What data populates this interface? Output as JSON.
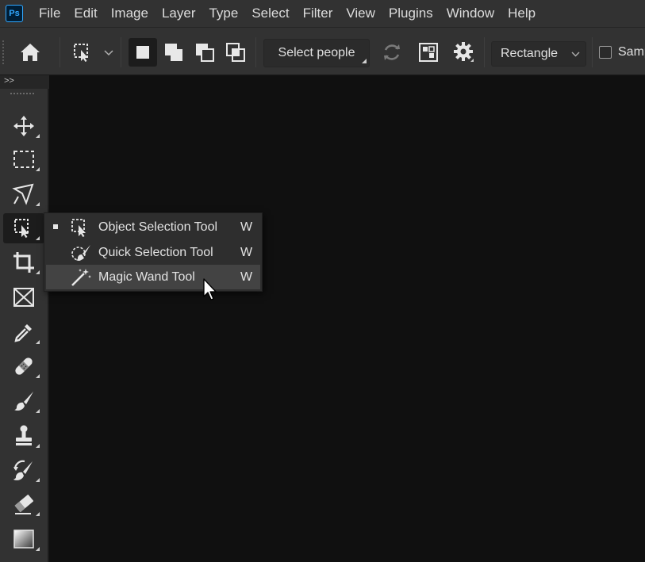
{
  "app": {
    "logo_text": "Ps"
  },
  "menubar": {
    "items": [
      "File",
      "Edit",
      "Image",
      "Layer",
      "Type",
      "Select",
      "Filter",
      "View",
      "Plugins",
      "Window",
      "Help"
    ]
  },
  "options_bar": {
    "select_subject_label": "Select people",
    "mode_select_value": "Rectangle",
    "sample_all_layers_label": "Samp",
    "sample_all_layers_checked": false
  },
  "toolbar": {
    "collapse_label": ">>",
    "tools": [
      {
        "name": "move-tool",
        "icon": "move-icon"
      },
      {
        "name": "rectangular-marquee-tool",
        "icon": "marquee-icon"
      },
      {
        "name": "lasso-tool",
        "icon": "lasso-icon"
      },
      {
        "name": "object-selection-tool",
        "icon": "object-selection-icon",
        "active": true
      },
      {
        "name": "crop-tool",
        "icon": "crop-icon"
      },
      {
        "name": "frame-tool",
        "icon": "frame-icon"
      },
      {
        "name": "eyedropper-tool",
        "icon": "eyedropper-icon"
      },
      {
        "name": "healing-brush-tool",
        "icon": "bandage-icon"
      },
      {
        "name": "brush-tool",
        "icon": "brush-icon"
      },
      {
        "name": "clone-stamp-tool",
        "icon": "stamp-icon"
      },
      {
        "name": "history-brush-tool",
        "icon": "history-brush-icon"
      },
      {
        "name": "eraser-tool",
        "icon": "eraser-icon"
      },
      {
        "name": "gradient-tool",
        "icon": "gradient-icon"
      }
    ]
  },
  "flyout": {
    "items": [
      {
        "label": "Object Selection Tool",
        "shortcut": "W",
        "selected": true,
        "icon": "object-selection-icon"
      },
      {
        "label": "Quick Selection Tool",
        "shortcut": "W",
        "selected": false,
        "icon": "quick-selection-icon"
      },
      {
        "label": "Magic Wand Tool",
        "shortcut": "W",
        "selected": false,
        "hovered": true,
        "icon": "magic-wand-icon"
      }
    ]
  },
  "colors": {
    "chrome": "#323232",
    "canvas": "#101010",
    "accent": "#31a8ff"
  }
}
